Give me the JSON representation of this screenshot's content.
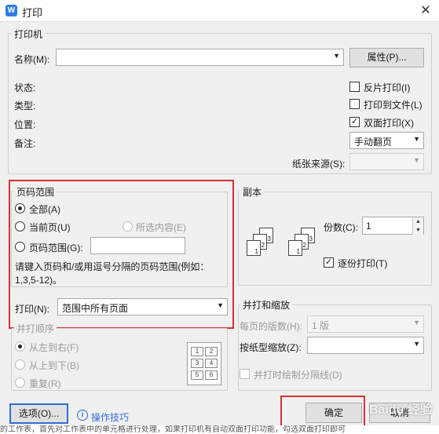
{
  "window": {
    "title": "打印",
    "app_icon": "W",
    "close": "✕"
  },
  "printer": {
    "group_label": "打印机",
    "name_label": "名称(M):",
    "name_value": "",
    "properties_button": "属性(P)...",
    "status_label": "状态:",
    "type_label": "类型:",
    "location_label": "位置:",
    "comment_label": "备注:",
    "reverse_print": {
      "label": "反片打印(I)",
      "checked": false
    },
    "print_to_file": {
      "label": "打印到文件(L)",
      "checked": false
    },
    "duplex_print": {
      "label": "双面打印(X)",
      "checked": true
    },
    "duplex_mode": "手动翻页",
    "paper_source_label": "纸张来源(S):",
    "paper_source_value": ""
  },
  "page_range": {
    "group_label": "页码范围",
    "all": "全部(A)",
    "current": "当前页(U)",
    "selection": "所选内容(E)",
    "pages": "页码范围(G):",
    "pages_value": "",
    "selected": "all",
    "hint": "请键入页码和/或用逗号分隔的页码范围(例如：1,3,5-12)。"
  },
  "print_what": {
    "label": "打印(N):",
    "value": "范围中所有页面"
  },
  "print_order": {
    "group_label": "并打顺序",
    "left_to_right": "从左到右(F)",
    "top_to_bottom": "从上到下(B)",
    "repeat": "重复(R)",
    "preview_cells": [
      "1",
      "2",
      "3",
      "4",
      "5",
      "6"
    ]
  },
  "copies": {
    "group_label": "副本",
    "count_label": "份数(C):",
    "count_value": "1",
    "collate": {
      "label": "逐份打印(T)",
      "checked": true
    },
    "stack1": [
      "1",
      "2",
      "3"
    ],
    "stack2": [
      "1",
      "2",
      "3"
    ]
  },
  "zoom": {
    "group_label": "并打和缩放",
    "pages_per_sheet_label": "每页的版数(H):",
    "pages_per_sheet_value": "1 版",
    "scale_label": "按纸型缩放(Z):",
    "scale_value": "",
    "draw_lines": {
      "label": "并打时绘制分隔线(D)",
      "checked": false
    }
  },
  "footer": {
    "options_button": "选项(O)...",
    "tips_link": "操作技巧",
    "ok_button": "确定",
    "cancel_button": "取消",
    "watermark": "Baidu 经验",
    "background_text": "的工作表，首先对工作表中的单元格进行处理，如果打印机有自动双面打印功能，勾选双面打印即可"
  },
  "colors": {
    "highlight": "#d73232",
    "link": "#2f6fd6",
    "app_icon": "#2f7de1"
  }
}
